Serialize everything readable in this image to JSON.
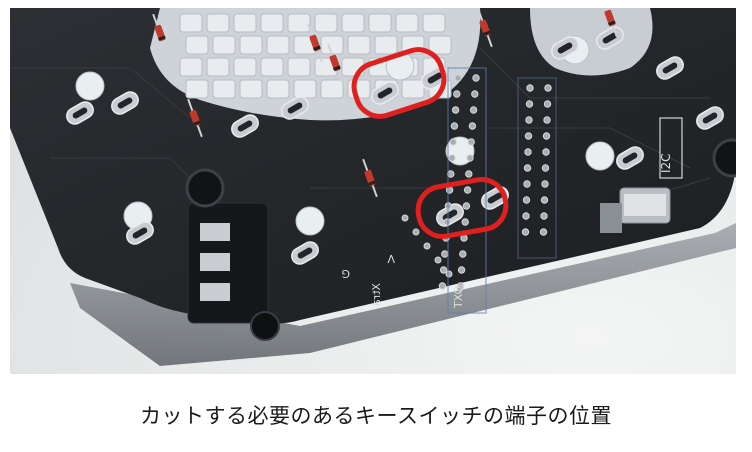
{
  "photo": {
    "silkscreen": {
      "i2c": "I2C",
      "xtra": "Xtra",
      "g": "G",
      "v": "V",
      "txo": "TXO"
    }
  },
  "caption": "カットする必要のあるキースイッチの端子の位置"
}
